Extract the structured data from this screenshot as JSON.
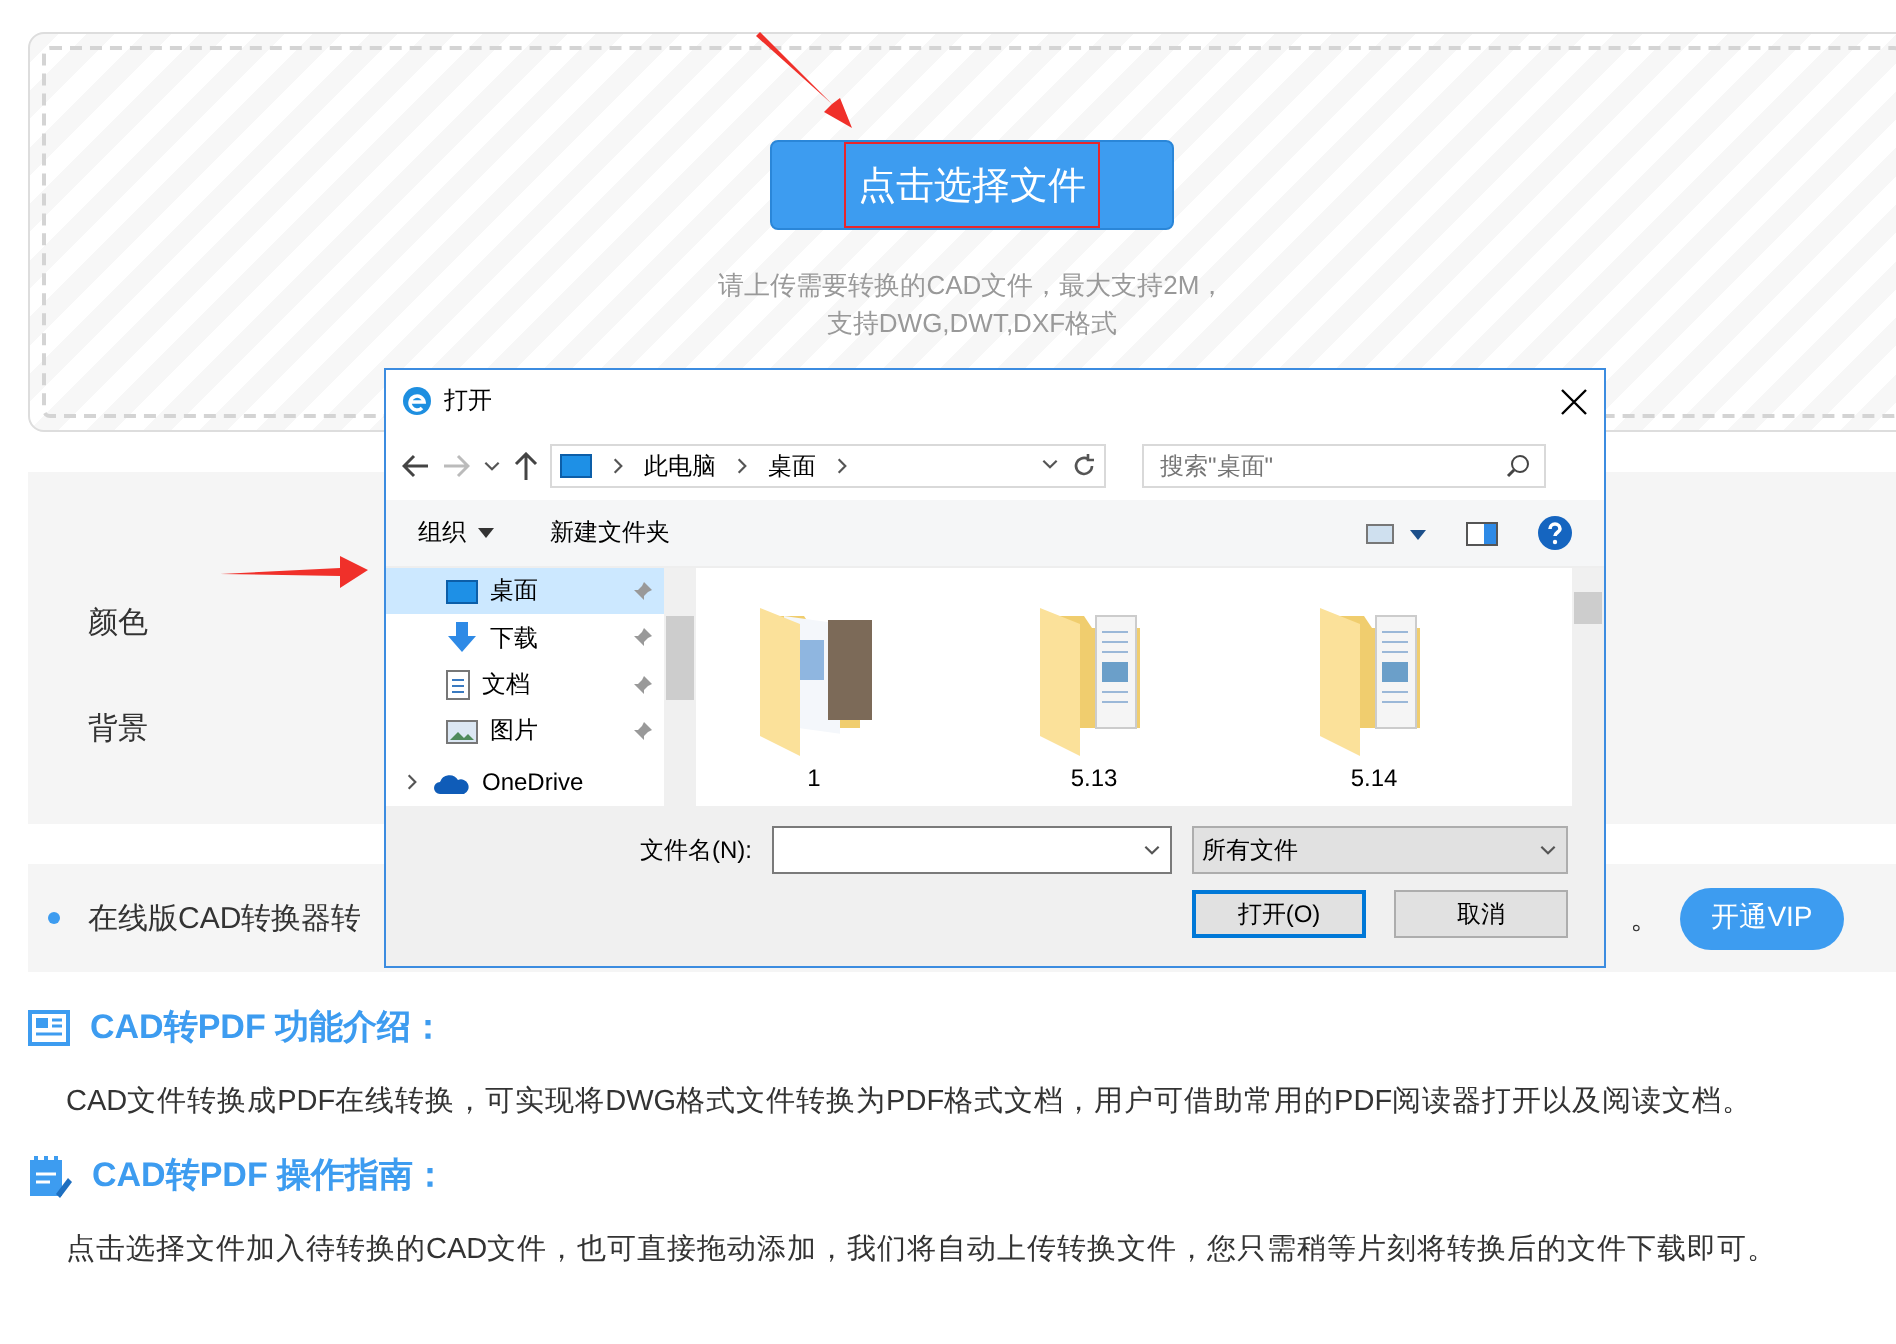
{
  "upload": {
    "button": "点击选择文件",
    "hint_lines": [
      "请上传需要转换的CAD文件，最大支持2M，",
      "支持DWG,DWT,DXF格式"
    ]
  },
  "settings": {
    "labels": [
      "颜色",
      "背景"
    ]
  },
  "notice": {
    "text": "在线版CAD转换器转",
    "text_end": "。",
    "button": "开通VIP"
  },
  "sections": [
    {
      "kind": "intro",
      "title": "CAD转PDF 功能介绍：",
      "body": "CAD文件转换成PDF在线转换，可实现将DWG格式文件转换为PDF格式文档，用户可借助常用的PDF阅读器打开以及阅读文档。"
    },
    {
      "kind": "guide",
      "title": "CAD转PDF 操作指南：",
      "body": "点击选择文件加入待转换的CAD文件，也可直接拖动添加，我们将自动上传转换文件，您只需稍等片刻将转换后的文件下载即可。"
    }
  ],
  "dialog": {
    "title": "打开",
    "breadcrumb": [
      "此电脑",
      "桌面"
    ],
    "search": {
      "placeholder": "搜索\"桌面\""
    },
    "toolbar": [
      "组织",
      "新建文件夹"
    ],
    "nav": [
      {
        "label": "桌面",
        "kind": "desktop",
        "selected": true
      },
      {
        "label": "下载",
        "kind": "download",
        "selected": false
      },
      {
        "label": "文档",
        "kind": "document",
        "selected": false
      },
      {
        "label": "图片",
        "kind": "pictures",
        "selected": false
      },
      {
        "label": "OneDrive",
        "kind": "cloud",
        "selected": false
      }
    ],
    "files": [
      {
        "name": "1",
        "kind": "photos"
      },
      {
        "name": "5.13",
        "kind": "docs"
      },
      {
        "name": "5.14",
        "kind": "docs"
      }
    ],
    "filename_label": "文件名(N):",
    "filter": "所有文件",
    "buttons": [
      {
        "label": "打开(O)",
        "primary": true
      },
      {
        "label": "取消",
        "primary": false
      }
    ]
  }
}
